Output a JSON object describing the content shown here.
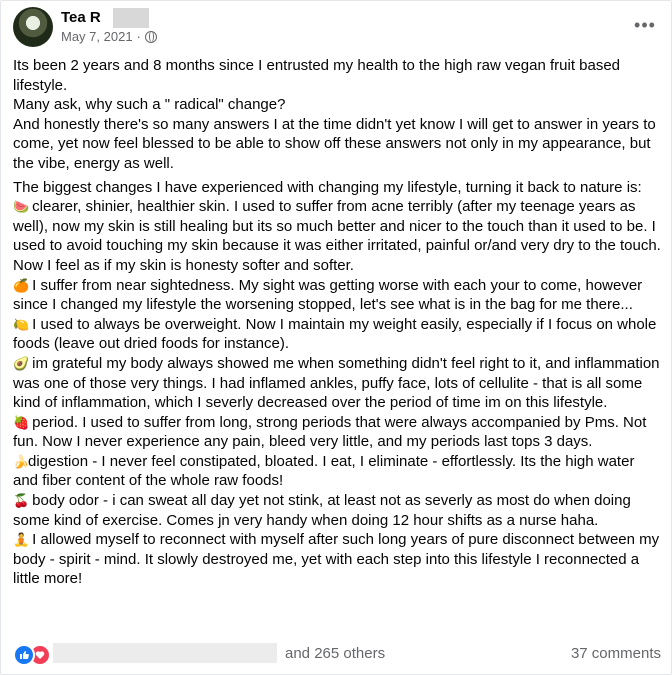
{
  "post": {
    "author": "Tea R",
    "date": "May 7, 2021",
    "separator": "·",
    "more_icon": "ellipsis-icon",
    "privacy_icon": "globe-icon"
  },
  "content": {
    "intro": [
      "Its been 2 years and 8 months since I entrusted my health to the high raw vegan fruit based lifestyle.",
      "Many ask, why such a \" radical\" change?",
      "And honestly there's so many answers I at the time didn't yet know I will get to answer in years to come, yet now feel blessed to be able to show off these answers not only in my appearance, but the vibe, energy as well."
    ],
    "lead": "The biggest changes I have experienced with changing my lifestyle, turning it back to nature is:",
    "items": [
      {
        "emoji": "🍉",
        "text": "clearer, shinier, healthier skin. I used to suffer from acne terribly (after my teenage years as well), now my skin is still healing but its so much better and nicer to the touch than it used to be. I used to avoid touching my skin because it was either irritated, painful or/and very dry to the touch. Now I feel as if my skin is honesty softer and softer."
      },
      {
        "emoji": "🍊",
        "text": "I suffer from near sightedness. My sight was getting worse with each your to come, however since I changed my lifestyle the worsening stopped, let's see what is in the bag for me there..."
      },
      {
        "emoji": "🍋",
        "text": "I used to always be overweight. Now I maintain my weight easily, especially if I focus on whole foods (leave out dried foods for instance)."
      },
      {
        "emoji": "🥑",
        "text": "im grateful my body always showed me when something didn't feel right to it, and inflammation was one of those very things. I had inflamed ankles, puffy face, lots of cellulite - that is all some kind of inflammation, which I severly decreased over the period of time im on this lifestyle."
      },
      {
        "emoji": "🍓",
        "text": "period. I used to suffer from long, strong periods that were always accompanied by Pms. Not fun. Now I never experience any pain, bleed very little, and my periods last tops 3 days."
      },
      {
        "emoji": "🍌",
        "text": "digestion - I never feel constipated, bloated. I eat, I eliminate - effortlessly. Its the high water and fiber content of the whole raw foods!"
      },
      {
        "emoji": "🍒",
        "text": "body odor - i can sweat all day yet not stink, at least not as severly as most do when doing some kind of exercise. Comes jn very handy when doing 12 hour shifts as a nurse haha."
      },
      {
        "emoji": "🧘",
        "text": "I allowed myself to reconnect with myself after such long years of pure disconnect between my body - spirit - mind. It slowly destroyed me, yet with each step into this lifestyle I reconnected a little more!"
      }
    ]
  },
  "footer": {
    "reactors_text": "and 265 others",
    "comments_text": "37 comments",
    "like_icon": "thumbs-up-icon",
    "love_icon": "heart-icon"
  }
}
